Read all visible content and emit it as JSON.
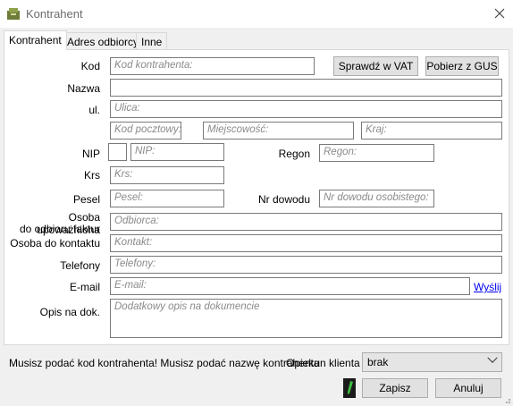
{
  "window": {
    "title": "Kontrahent"
  },
  "tabs": [
    "Kontrahent",
    "Adres odbiorcy",
    "Inne"
  ],
  "form": {
    "kod": {
      "label": "Kod",
      "placeholder": "Kod kontrahenta:"
    },
    "vat_button": "Sprawdź w VAT",
    "gus_button": "Pobierz z GUS",
    "nazwa": {
      "label": "Nazwa",
      "placeholder": ""
    },
    "ulica": {
      "label": "ul.",
      "placeholder": "Ulica:"
    },
    "kod_pocztowy": {
      "placeholder": "Kod pocztowy:"
    },
    "miejscowosc": {
      "placeholder": "Miejscowość:"
    },
    "kraj": {
      "placeholder": "Kraj:"
    },
    "nip": {
      "label": "NIP",
      "prefix_placeholder": "",
      "placeholder": "NIP:"
    },
    "regon": {
      "label": "Regon",
      "placeholder": "Regon:"
    },
    "krs": {
      "label": "Krs",
      "placeholder": "Krs:"
    },
    "pesel": {
      "label": "Pesel",
      "placeholder": "Pesel:"
    },
    "nr_dowodu": {
      "label": "Nr dowodu",
      "placeholder": "Nr dowodu osobistego:"
    },
    "odbiorca": {
      "label_line1": "Osoba upoważniona",
      "label_line2": "do odbioru faktur",
      "placeholder": "Odbiorca:"
    },
    "kontakt": {
      "label": "Osoba do kontaktu",
      "placeholder": "Kontakt:"
    },
    "telefony": {
      "label": "Telefony",
      "placeholder": "Telefony:"
    },
    "email": {
      "label": "E-mail",
      "placeholder": "E-mail:",
      "send_link": "Wyślij"
    },
    "opis": {
      "label": "Opis na dok.",
      "placeholder": "Dodatkowy opis na dokumencie"
    }
  },
  "footer": {
    "message": "Musisz podać kod kontrahenta! Musisz podać nazwę kontrahenta",
    "opiekun_label": "Opiekun klienta",
    "opiekun_value": "brak",
    "save_button": "Zapisz",
    "cancel_button": "Anuluj"
  }
}
